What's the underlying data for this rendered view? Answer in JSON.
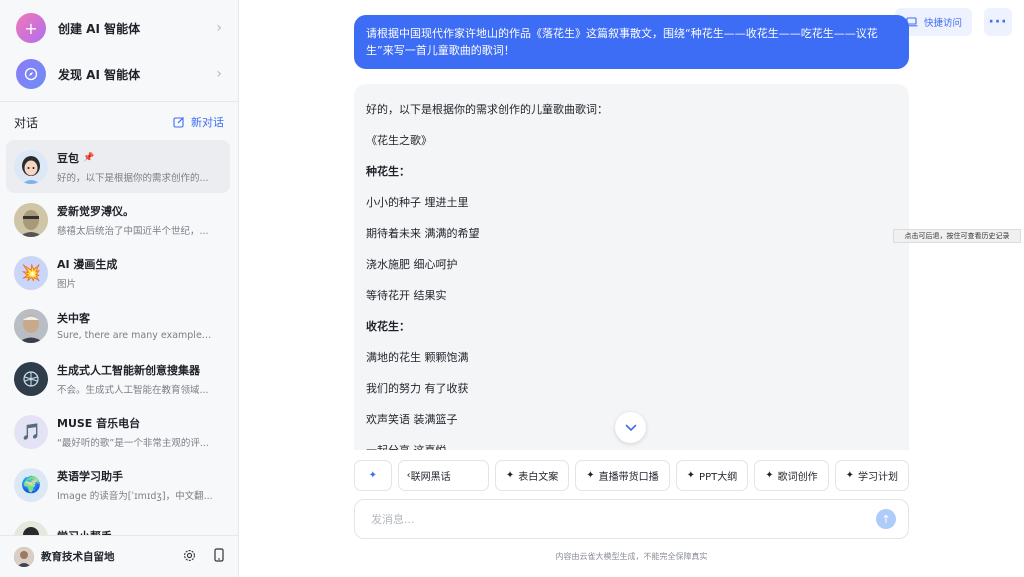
{
  "sidebar": {
    "create_agent": "创建 AI 智能体",
    "discover_agent": "发现 AI 智能体",
    "section_title": "对话",
    "new_chat": "新对话",
    "conversations": [
      {
        "title": "豆包",
        "subtitle": "好的，以下是根据你的需求创作的...",
        "pinned": true,
        "active": true,
        "avatar": "doubao-avatar"
      },
      {
        "title": "爱新觉罗溥仪。",
        "subtitle": "慈禧太后统治了中国近半个世纪，...",
        "avatar": "puyi-avatar"
      },
      {
        "title": "AI 漫画生成",
        "subtitle": "图片",
        "avatar": "comic-avatar"
      },
      {
        "title": "关中客",
        "subtitle": "Sure, there are many examples ...",
        "avatar": "guanzhongke-avatar"
      },
      {
        "title": "生成式人工智能新创意搜集器",
        "subtitle": "不会。生成式人工智能在教育领域...",
        "avatar": "brain-avatar"
      },
      {
        "title": "MUSE 音乐电台",
        "subtitle": "“最好听的歌”是一个非常主观的评...",
        "avatar": "music-note-avatar"
      },
      {
        "title": "英语学习助手",
        "subtitle": "Image 的读音为[ˈɪmɪdʒ]，中文翻...",
        "avatar": "globe-avatar"
      },
      {
        "title": "学习小帮手",
        "subtitle": "",
        "avatar": "study-avatar"
      }
    ],
    "user_name": "教育技术自留地"
  },
  "topbar": {
    "quick_access": "快捷访问",
    "more": "···"
  },
  "chat": {
    "user_message": "请根据中国现代作家许地山的作品《落花生》这篇叙事散文，围绕“种花生——收花生——吃花生——议花生”来写一首儿童歌曲的歌词！",
    "ai_lines": [
      {
        "text": "好的，以下是根据你的需求创作的儿童歌曲歌词：",
        "bold": false
      },
      {
        "text": "《花生之歌》",
        "bold": false
      },
      {
        "text": "种花生：",
        "bold": true
      },
      {
        "text": "小小的种子 埋进土里",
        "bold": false
      },
      {
        "text": "期待着未来 满满的希望",
        "bold": false
      },
      {
        "text": "浇水施肥 细心呵护",
        "bold": false
      },
      {
        "text": "等待花开 结果实",
        "bold": false
      },
      {
        "text": "收花生：",
        "bold": true
      },
      {
        "text": "满地的花生 颗颗饱满",
        "bold": false
      },
      {
        "text": "我们的努力 有了收获",
        "bold": false
      },
      {
        "text": "欢声笑语 装满篮子",
        "bold": false
      },
      {
        "text": "一起分享 这喜悦",
        "bold": false
      }
    ]
  },
  "tooltip": "点击可后退，按住可查看历史记录",
  "chips": [
    "联网黑话",
    "表白文案",
    "直播带货口播",
    "PPT大纲",
    "歌词创作",
    "学习计划"
  ],
  "input": {
    "placeholder": "发消息..."
  },
  "disclaimer": "内容由云雀大模型生成，不能完全保障真实",
  "colors": {
    "accent": "#3d6cf5",
    "sidebar_bg": "#f7f8fa",
    "bubble_bg": "#f4f5f7"
  }
}
